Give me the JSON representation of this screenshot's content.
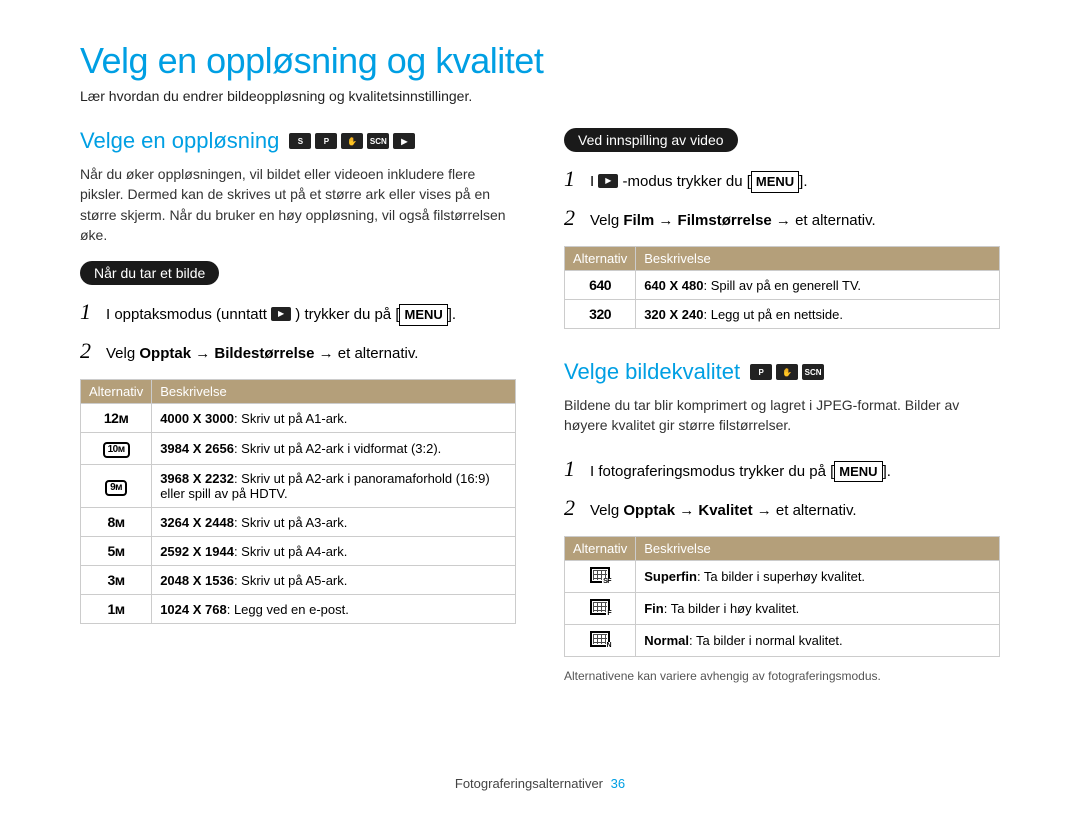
{
  "page_title": "Velg en oppløsning og kvalitet",
  "intro": "Lær hvordan du endrer bildeoppløsning og kvalitetsinnstillinger.",
  "left": {
    "heading": "Velge en oppløsning",
    "mode_icons": [
      "SMART",
      "P",
      "HAND",
      "SCN",
      "VID"
    ],
    "body": "Når du øker oppløsningen, vil bildet eller videoen inkludere flere piksler. Dermed kan de skrives ut på et større ark eller vises på en større skjerm. Når du bruker en høy oppløsning, vil også filstørrelsen øke.",
    "caption": "Når du tar et bilde",
    "step1_a": "I opptaksmodus (unntatt ",
    "step1_b": ") trykker du på [",
    "step1_c": "].",
    "step2_a": "Velg ",
    "step2_b": "Opptak → Bildestørrelse",
    "step2_c": " → et alternativ.",
    "table_headers": {
      "a": "Alternativ",
      "b": "Beskrivelse"
    },
    "rows": [
      {
        "icon_type": "text",
        "icon": "12ᴍ",
        "bold": "4000 X 3000",
        "desc": ": Skriv ut på A1-ark."
      },
      {
        "icon_type": "box",
        "icon": "10ᴍ",
        "bold": "3984 X 2656",
        "desc": ": Skriv ut på A2-ark i vidformat (3:2)."
      },
      {
        "icon_type": "box",
        "icon": "9ᴍ",
        "bold": "3968 X 2232",
        "desc": ": Skriv ut på A2-ark i panoramaforhold (16:9) eller spill av på HDTV."
      },
      {
        "icon_type": "text",
        "icon": "8ᴍ",
        "bold": "3264 X 2448",
        "desc": ": Skriv ut på A3-ark."
      },
      {
        "icon_type": "text",
        "icon": "5ᴍ",
        "bold": "2592 X 1944",
        "desc": ": Skriv ut på A4-ark."
      },
      {
        "icon_type": "text",
        "icon": "3ᴍ",
        "bold": "2048 X 1536",
        "desc": ": Skriv ut på A5-ark."
      },
      {
        "icon_type": "text",
        "icon": "1ᴍ",
        "bold": "1024 X 768",
        "desc": ": Legg ved en e-post."
      }
    ]
  },
  "right_video": {
    "caption": "Ved innspilling av video",
    "step1_a": "I ",
    "step1_b": "-modus trykker du [",
    "step1_c": "].",
    "step2_a": "Velg ",
    "step2_b": "Film → Filmstørrelse",
    "step2_c": " → et alternativ.",
    "table_headers": {
      "a": "Alternativ",
      "b": "Beskrivelse"
    },
    "rows": [
      {
        "icon": "640",
        "bold": "640 X 480",
        "desc": ": Spill av på en generell TV."
      },
      {
        "icon": "320",
        "bold": "320 X 240",
        "desc": ": Legg ut på en nettside."
      }
    ]
  },
  "right_quality": {
    "heading": "Velge bildekvalitet",
    "mode_icons": [
      "P",
      "HAND",
      "SCN"
    ],
    "body": "Bildene du tar blir komprimert og lagret i JPEG-format. Bilder av høyere kvalitet gir større filstørrelser.",
    "step1_a": "I fotograferingsmodus trykker du på [",
    "step1_b": "].",
    "step2_a": "Velg ",
    "step2_b": "Opptak → Kvalitet",
    "step2_c": " → et alternativ.",
    "table_headers": {
      "a": "Alternativ",
      "b": "Beskrivelse"
    },
    "rows": [
      {
        "q": "sf",
        "bold": "Superfin",
        "desc": ": Ta bilder i superhøy kvalitet."
      },
      {
        "q": "f",
        "bold": "Fin",
        "desc": ": Ta bilder i høy kvalitet."
      },
      {
        "q": "n",
        "bold": "Normal",
        "desc": ": Ta bilder i normal kvalitet."
      }
    ],
    "footnote": "Alternativene kan variere avhengig av fotograferingsmodus."
  },
  "menu_label": "MENU",
  "footer": {
    "section": "Fotograferingsalternativer",
    "page": "36"
  }
}
